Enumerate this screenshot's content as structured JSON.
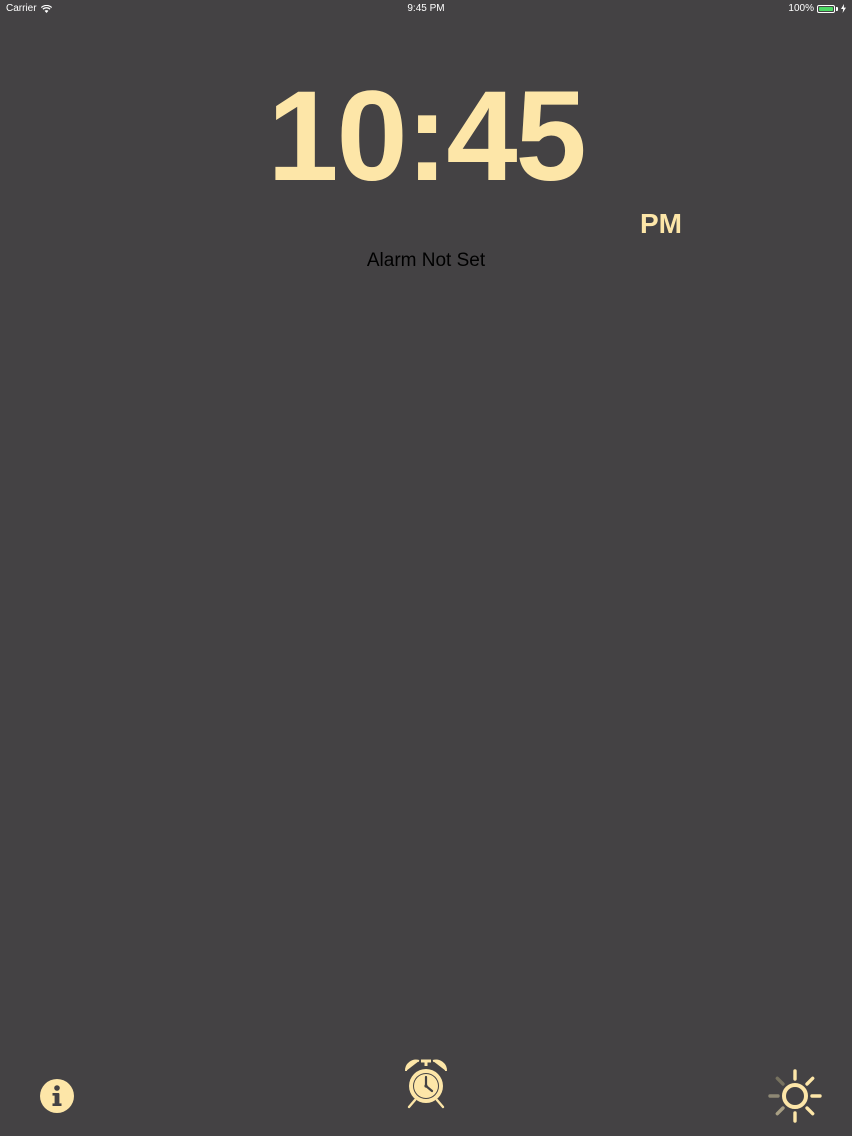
{
  "status_bar": {
    "carrier": "Carrier",
    "time": "9:45 PM",
    "battery": "100%",
    "battery_color": "#4cd964"
  },
  "clock": {
    "time": "10:45",
    "ampm": "PM",
    "color": "#fde6a8"
  },
  "alarm": {
    "status": "Alarm Not Set"
  },
  "toolbar": {
    "info_icon": "info-icon",
    "alarm_icon": "alarm-clock-icon",
    "brightness_icon": "brightness-icon"
  },
  "theme": {
    "background": "#444244"
  }
}
